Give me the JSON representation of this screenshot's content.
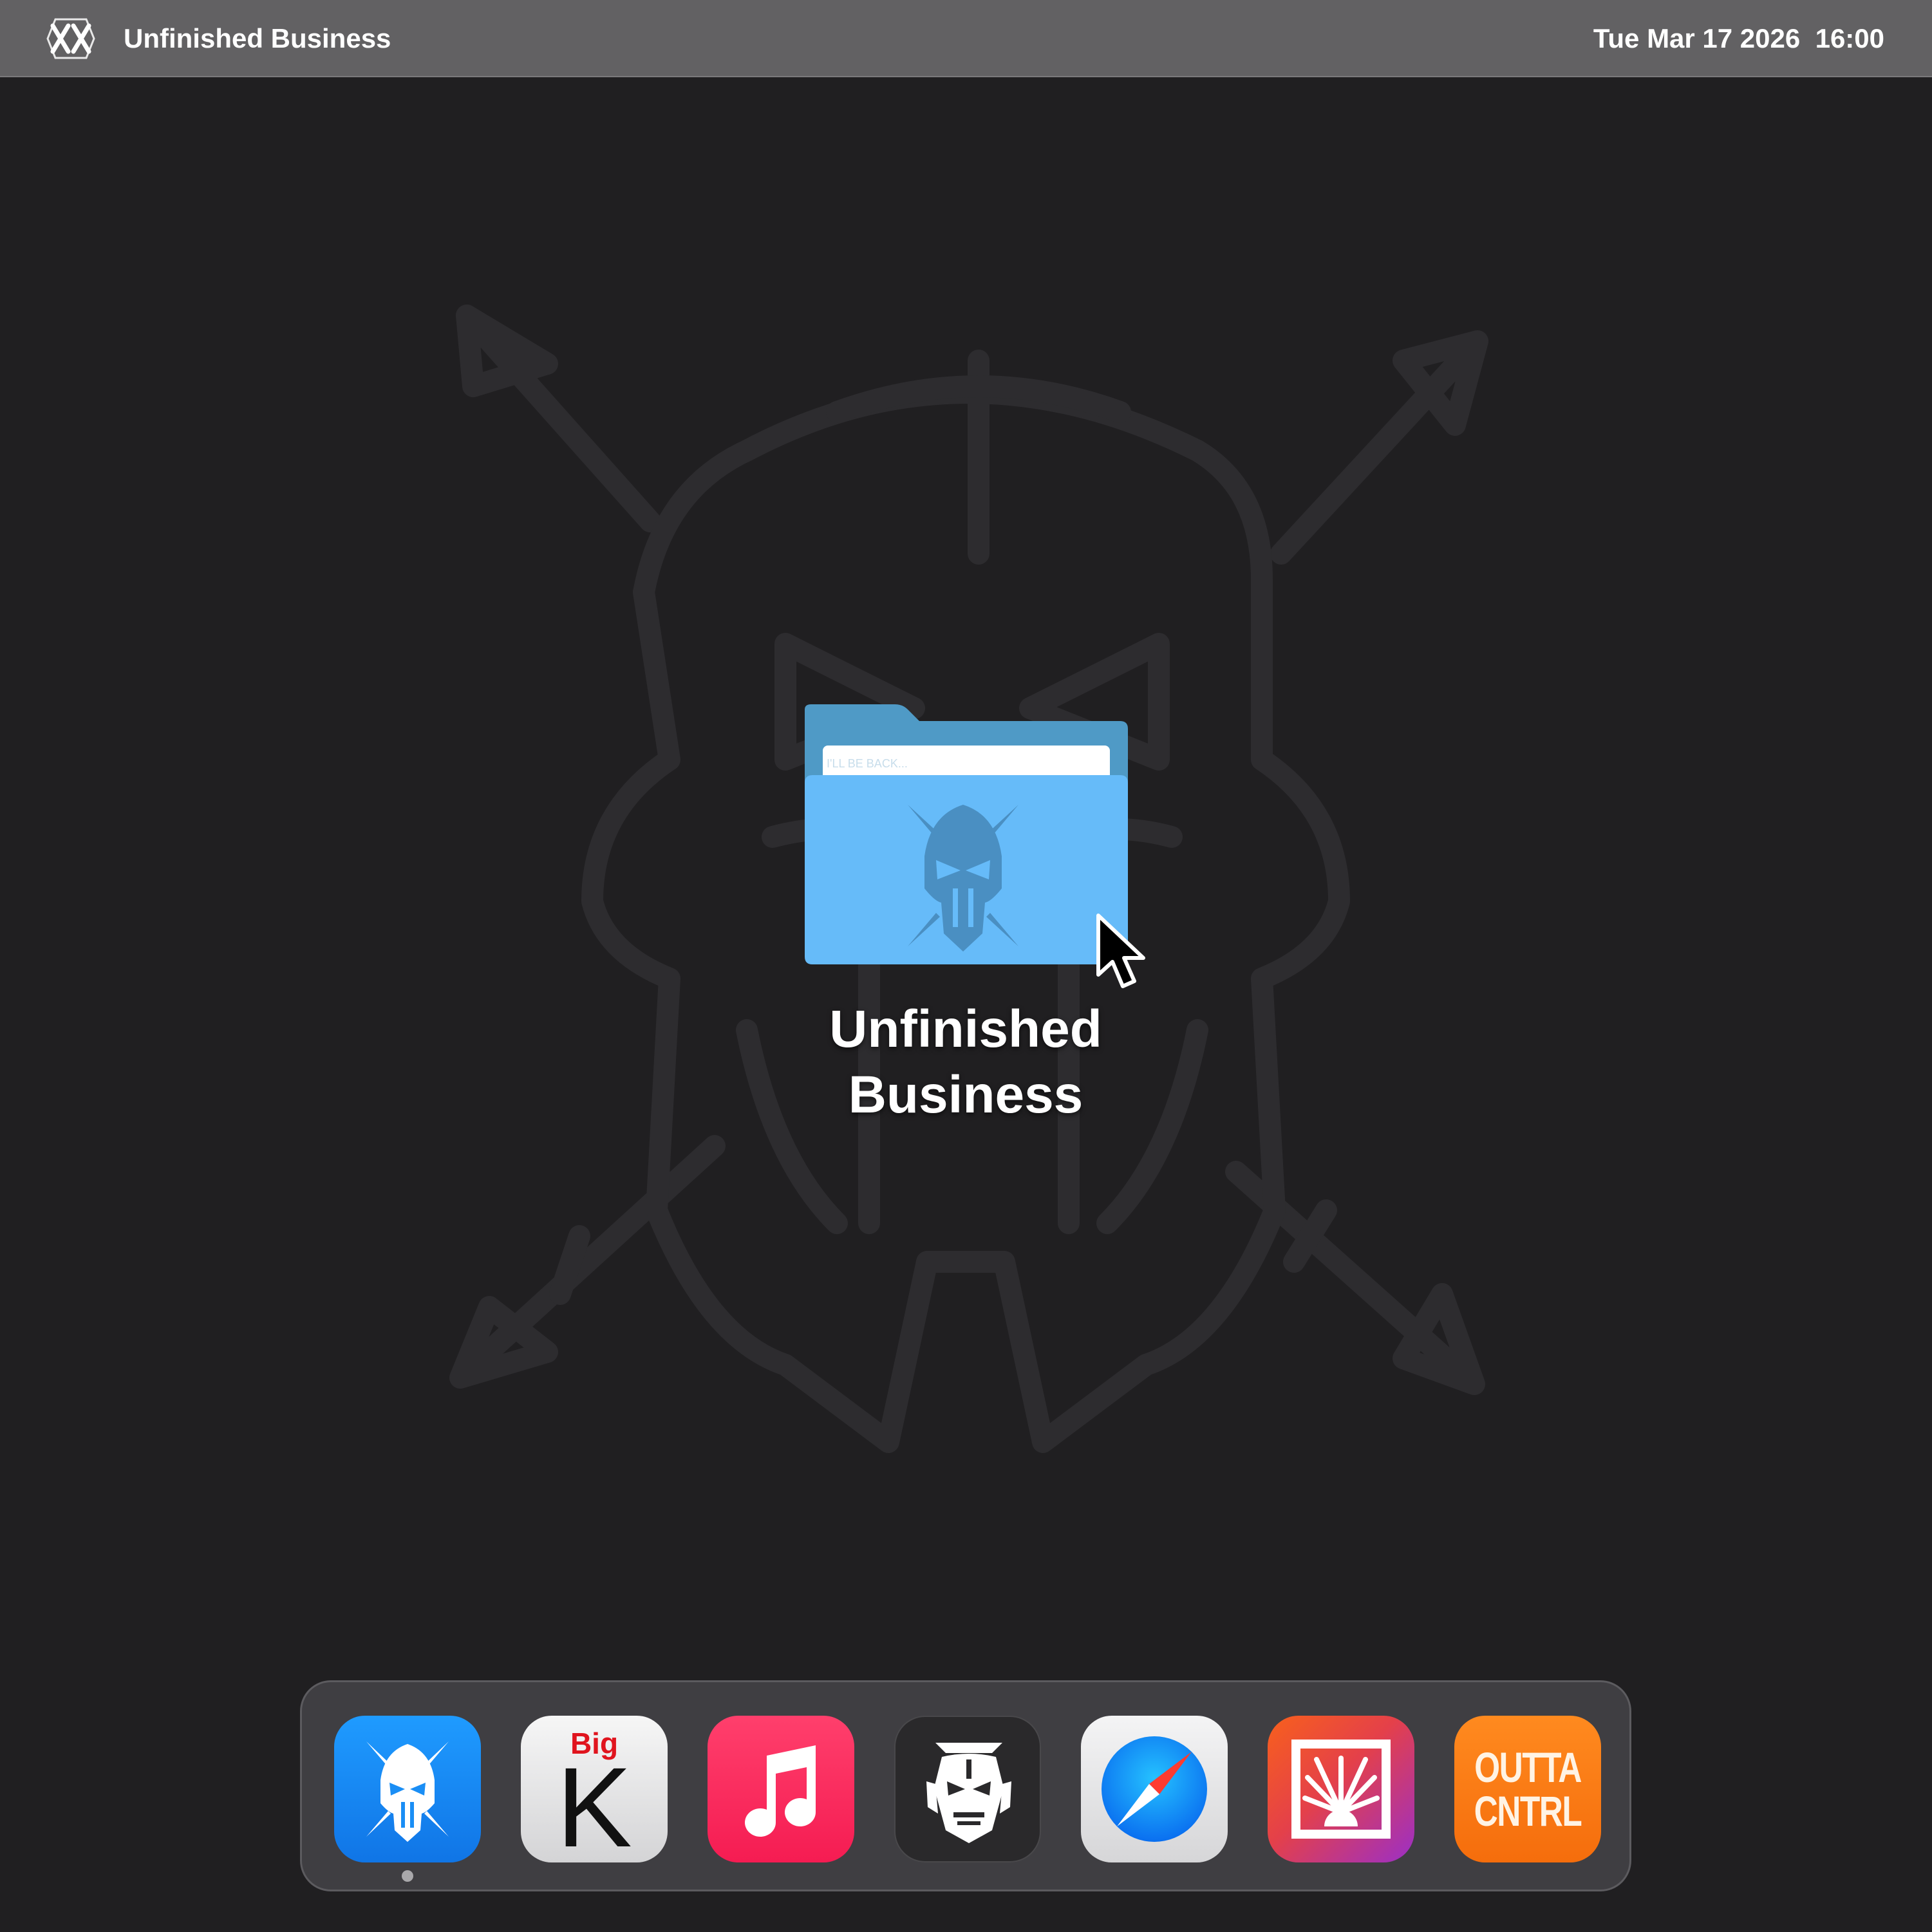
{
  "menubar": {
    "logo_icon": "xx-logo-icon",
    "app_title": "Unfinished Business",
    "clock": "Tue Mar 17 2026  16:00"
  },
  "wallpaper": {
    "emblem_icon": "spartan-helmet-crossed-spears-icon"
  },
  "desktop": {
    "folder": {
      "label": "Unfinished Business",
      "label_line1": "Unfinished",
      "label_line2": "Business",
      "icon": "spartan-folder-icon",
      "paper_text": "I'LL BE BACK...",
      "color": "#66bbf9"
    }
  },
  "dock": {
    "items": [
      {
        "name": "spartan-app",
        "icon": "spartan-helmet-icon",
        "color": "#1a8ef5",
        "running": true
      },
      {
        "name": "big-k-app",
        "icon": "big-k-icon",
        "top_text": "Big",
        "letter": "K",
        "running": false
      },
      {
        "name": "music-app",
        "icon": "music-note-icon",
        "color": "#fb2d5c",
        "running": false
      },
      {
        "name": "samurai-app",
        "icon": "samurai-mask-icon",
        "color": "#2a292b",
        "running": false
      },
      {
        "name": "safari-app",
        "icon": "compass-icon",
        "running": false
      },
      {
        "name": "sunrise-app",
        "icon": "sunrise-icon",
        "running": false
      },
      {
        "name": "outta-cntrl-app",
        "icon": "outta-cntrl-icon",
        "text_line1": "OUTTA",
        "text_line2": "CNTRL",
        "color": "#fb7a14",
        "running": false
      }
    ]
  }
}
